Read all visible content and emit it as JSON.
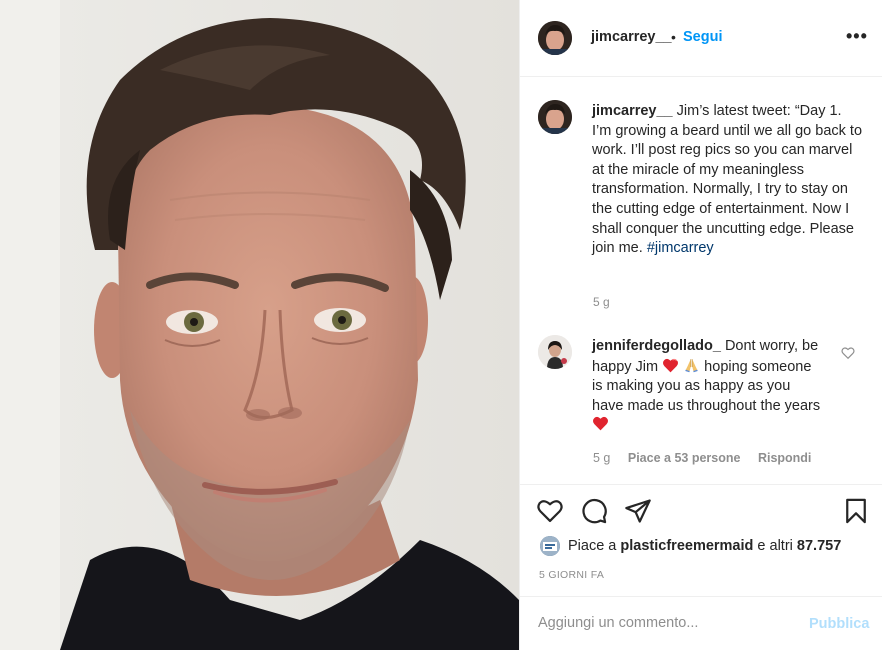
{
  "post": {
    "image_alt": "Selfie of a man with tousled dark hair and light stubble against a white wall"
  },
  "header": {
    "username": "jimcarrey__",
    "dot": "•",
    "follow_label": "Segui",
    "more_label": "•••"
  },
  "caption": {
    "username": "jimcarrey__",
    "text": " Jim’s latest tweet: “Day 1. I’m growing a beard until we all go back to work. I’ll post reg pics so you can marvel at the miracle of my meaningless transformation. Normally, I try to stay on the cutting edge of entertainment. Now I shall conquer the uncutting edge. Please join me. ",
    "hashtag": "#jimcarrey",
    "time": "5 g"
  },
  "comment": {
    "username": "jenniferdegollado_",
    "text_part1": " Dont worry, be happy Jim ",
    "text_part2": " hoping someone is making you as happy as you have made us throughout the years ",
    "time": "5 g",
    "likes": "Piace a 53 persone",
    "reply_label": "Rispondi"
  },
  "actions": {
    "likes_prefix": "Piace a ",
    "liked_by": "plasticfreemermaid",
    "likes_middle": " e altri ",
    "likes_count": "87.757",
    "timestamp": "5 giorni fa"
  },
  "add_comment": {
    "placeholder": "Aggiungi un commento...",
    "publish_label": "Pubblica"
  },
  "icons": {
    "like": "heart-outline-icon",
    "comment": "comment-bubble-icon",
    "share": "paper-plane-icon",
    "save": "bookmark-icon",
    "more": "more-dots-icon"
  },
  "colors": {
    "link_blue": "#0095f6",
    "publish_disabled": "#b2dffc",
    "hashtag": "#00376b",
    "secondary_text": "#8e8e8e",
    "emoji_heart": "#e0242f"
  }
}
